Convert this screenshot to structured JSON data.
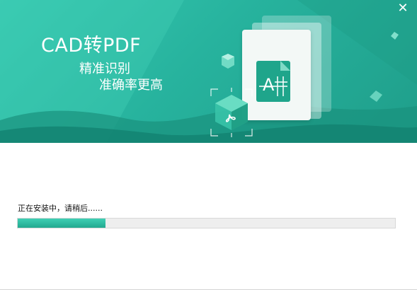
{
  "banner": {
    "headline": "CAD转PDF",
    "tagline1": "精准识别",
    "tagline2": "准确率更高",
    "close_icon": "close-icon",
    "close_glyph": "✕"
  },
  "install": {
    "status_text": "正在安装中，请稍后......",
    "progress": 0.232
  },
  "colors": {
    "accent": "#27b39e",
    "progress_fill": "#2bb79c",
    "progress_track": "#eeeeee"
  }
}
